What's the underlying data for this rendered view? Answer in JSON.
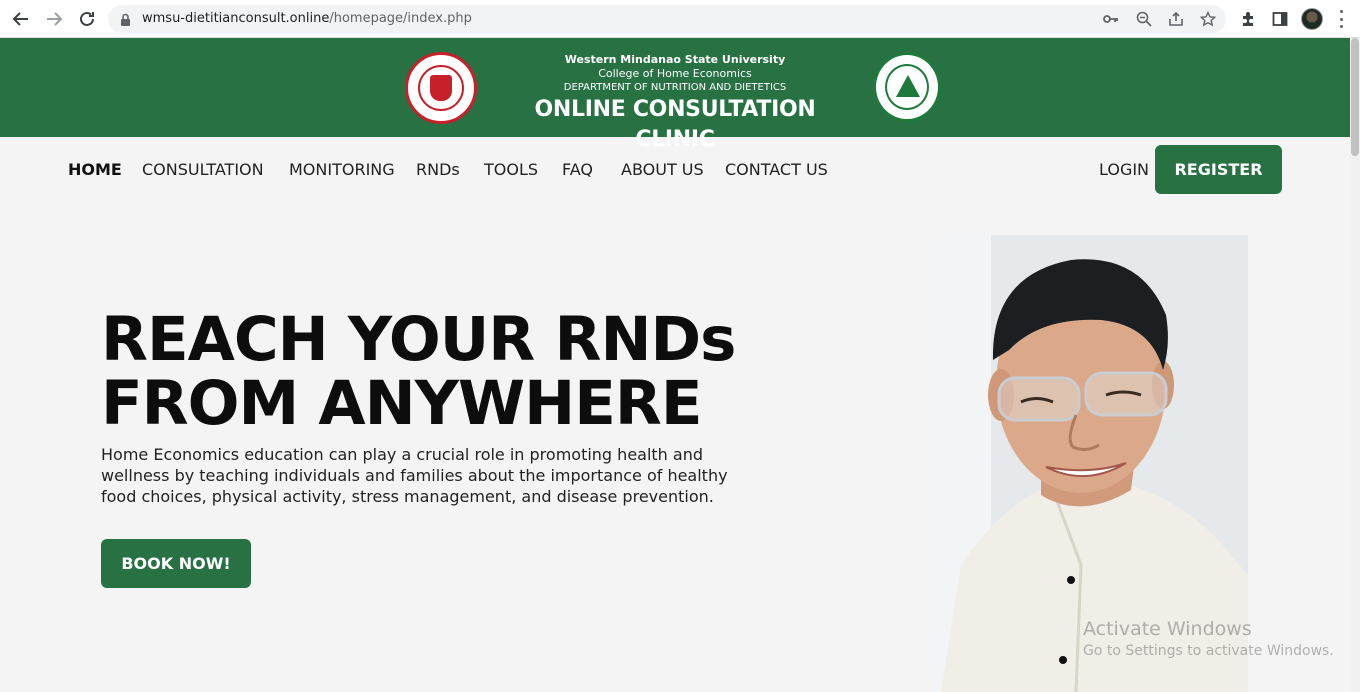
{
  "browser": {
    "url_host": "wmsu-dietitianconsult.online",
    "url_path": "/homepage/index.php"
  },
  "banner": {
    "university": "Western Mindanao State University",
    "college": "College of Home Economics",
    "department": "DEPARTMENT OF NUTRITION AND DIETETICS",
    "title": "ONLINE CONSULTATION CLINIC"
  },
  "nav": {
    "items": [
      "HOME",
      "CONSULTATION",
      "MONITORING",
      "RNDs",
      "TOOLS",
      "FAQ",
      "ABOUT US",
      "CONTACT US"
    ],
    "login": "LOGIN",
    "register": "REGISTER"
  },
  "hero": {
    "title": "REACH YOUR RNDs FROM ANYWHERE",
    "description": "Home Economics education can play a crucial role in promoting health and wellness by teaching individuals and families about the importance of healthy food choices, physical activity, stress management, and disease prevention.",
    "cta": "BOOK NOW!"
  },
  "watermark": {
    "line1": "Activate Windows",
    "line2": "Go to Settings to activate Windows."
  },
  "colors": {
    "brand_green": "#277143",
    "background": "#f4f4f4"
  }
}
